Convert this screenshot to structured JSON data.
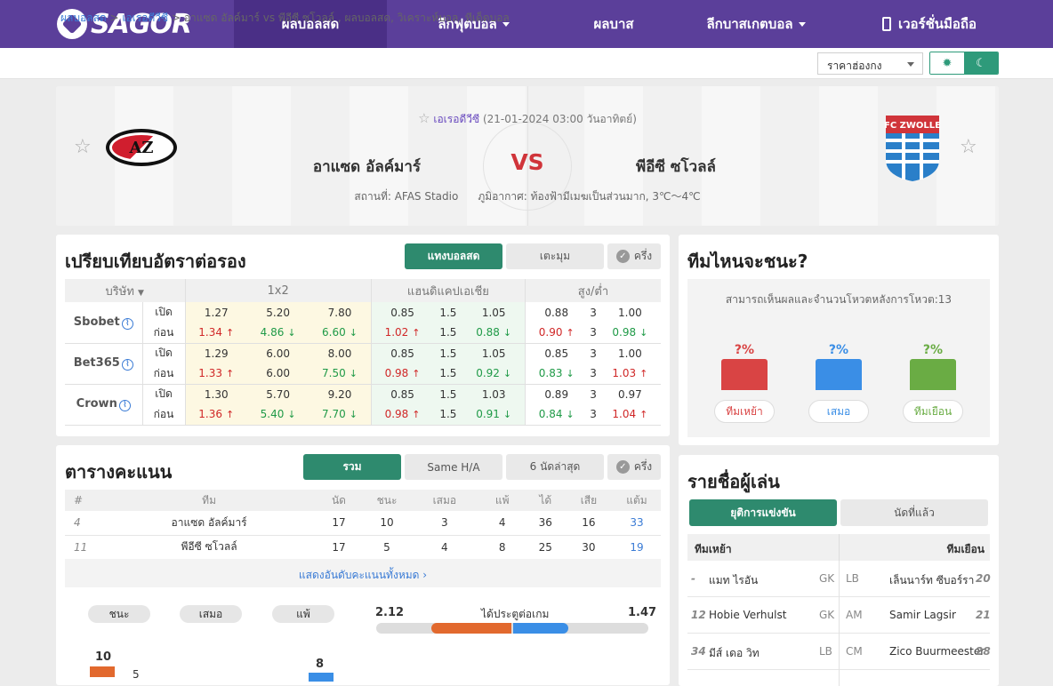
{
  "nav": {
    "logo": "SAGOR",
    "items": [
      "ผลบอลสด",
      "ลีกฟุตบอล",
      "ผลบาส",
      "ลีกบาสเกตบอล",
      "เวอร์ชั่นมือถือ"
    ]
  },
  "breadcrumb": {
    "home": "ผลบอลสด",
    "league": "เอเรอดีวีซี",
    "rest": "อาแซด อัลค์มาร์ vs  พีอีซี ซโวลล์ ,  ผลบอลสด,  วิเคราะห์บอล,  ทีเด็ดบอล"
  },
  "odds_select": "ราคาฮ่องกง",
  "match": {
    "league": "เอเรอดีวีซี",
    "datetime": "(21-01-2024 03:00 วันอาทิตย์)",
    "home": "อาแซด อัลค์มาร์",
    "away": "พีอีซี ซโวลล์",
    "vs": "VS",
    "home_logo": "AZ",
    "away_logo": "FC ZWOLLE",
    "venue": "สถานที่: AFAS Stadio",
    "weather": "ภูมิอากาศ: ท้องฟ้ามีเมฆเป็นส่วนมาก, 3℃～4℃"
  },
  "odds": {
    "title": "เปรียบเทียบอัตราต่อรอง",
    "tabs": [
      "แทงบอลสด",
      "เตะมุม",
      "ครึ่ง"
    ],
    "headers": [
      "บริษัท",
      "1x2",
      "แฮนดิแคปเอเชีย",
      "สูง/ต่ำ"
    ],
    "open": "เปิด",
    "before": "ก่อน",
    "rows": [
      {
        "company": "Sbobet",
        "open": [
          "1.27",
          "5.20",
          "7.80",
          "0.85",
          "1.5",
          "1.05",
          "0.88",
          "3",
          "1.00"
        ],
        "prev": [
          "1.34",
          "4.86",
          "6.60",
          "1.02",
          "1.5",
          "0.88",
          "0.90",
          "3",
          "0.98"
        ],
        "dir": [
          "u",
          "d",
          "d",
          "u",
          "",
          "d",
          "u",
          "",
          "d"
        ]
      },
      {
        "company": "Bet365",
        "open": [
          "1.29",
          "6.00",
          "8.00",
          "0.85",
          "1.5",
          "1.05",
          "0.85",
          "3",
          "1.00"
        ],
        "prev": [
          "1.33",
          "6.00",
          "7.50",
          "0.98",
          "1.5",
          "0.92",
          "0.83",
          "3",
          "1.03"
        ],
        "dir": [
          "u",
          "",
          "d",
          "u",
          "",
          "d",
          "d",
          "",
          "u"
        ]
      },
      {
        "company": "Crown",
        "open": [
          "1.30",
          "5.70",
          "9.20",
          "0.85",
          "1.5",
          "1.03",
          "0.89",
          "3",
          "0.97"
        ],
        "prev": [
          "1.36",
          "5.40",
          "7.70",
          "0.98",
          "1.5",
          "0.91",
          "0.84",
          "3",
          "1.04"
        ],
        "dir": [
          "u",
          "d",
          "d",
          "u",
          "",
          "d",
          "d",
          "",
          "u"
        ]
      }
    ]
  },
  "standings": {
    "title": "ตารางคะแนน",
    "tabs": [
      "รวม",
      "Same H/A",
      "6 นัดล่าสุด",
      "ครึ่ง"
    ],
    "headers": [
      "#",
      "ทีม",
      "นัด",
      "ชนะ",
      "เสมอ",
      "แพ้",
      "ได้",
      "เสีย",
      "แต้ม"
    ],
    "rows": [
      [
        "4",
        "อาแซด อัลค์มาร์",
        "17",
        "10",
        "3",
        "4",
        "36",
        "16",
        "33"
      ],
      [
        "11",
        "พีอีซี ซโวลล์",
        "17",
        "5",
        "4",
        "8",
        "25",
        "30",
        "19"
      ]
    ],
    "show_all": "แสดงอันดับคะแนนทั้งหมด"
  },
  "summary": {
    "labels": [
      "ชนะ",
      "เสมอ",
      "แพ้"
    ],
    "goals_label": "ได้ประตูต่อเกม",
    "home_goals": "2.12",
    "away_goals": "1.47",
    "home_wins": "10",
    "away_wins": "8",
    "home_draws": "5"
  },
  "vote": {
    "title": "ทีมไหนจะชนะ?",
    "note": "สามารถเห็นผลและจำนวนโหวตหลังการโหวต:13",
    "pcts": [
      "?%",
      "?%",
      "?%"
    ],
    "buttons": [
      "ทีมเหย้า",
      "เสมอ",
      "ทีมเยือน"
    ],
    "colors": [
      "#d94444",
      "#3a8ee6",
      "#6aac44"
    ]
  },
  "players": {
    "title": "รายชื่อผู้เล่น",
    "tabs": [
      "ยุติการแข่งขัน",
      "นัดที่แล้ว"
    ],
    "home_label": "ทีมเหย้า",
    "away_label": "ทีมเยือน",
    "rows": [
      [
        "-",
        "แมท ไรอัน",
        "GK",
        "LB",
        "เล็นนาร์ท ซีบอร์รา",
        "20"
      ],
      [
        "12",
        "Hobie Verhulst",
        "GK",
        "AM",
        "Samir Lagsir",
        "21"
      ],
      [
        "34",
        "มีส์ เดอ วิท",
        "LB",
        "CM",
        "Zico Buurmeester",
        "28"
      ]
    ]
  }
}
